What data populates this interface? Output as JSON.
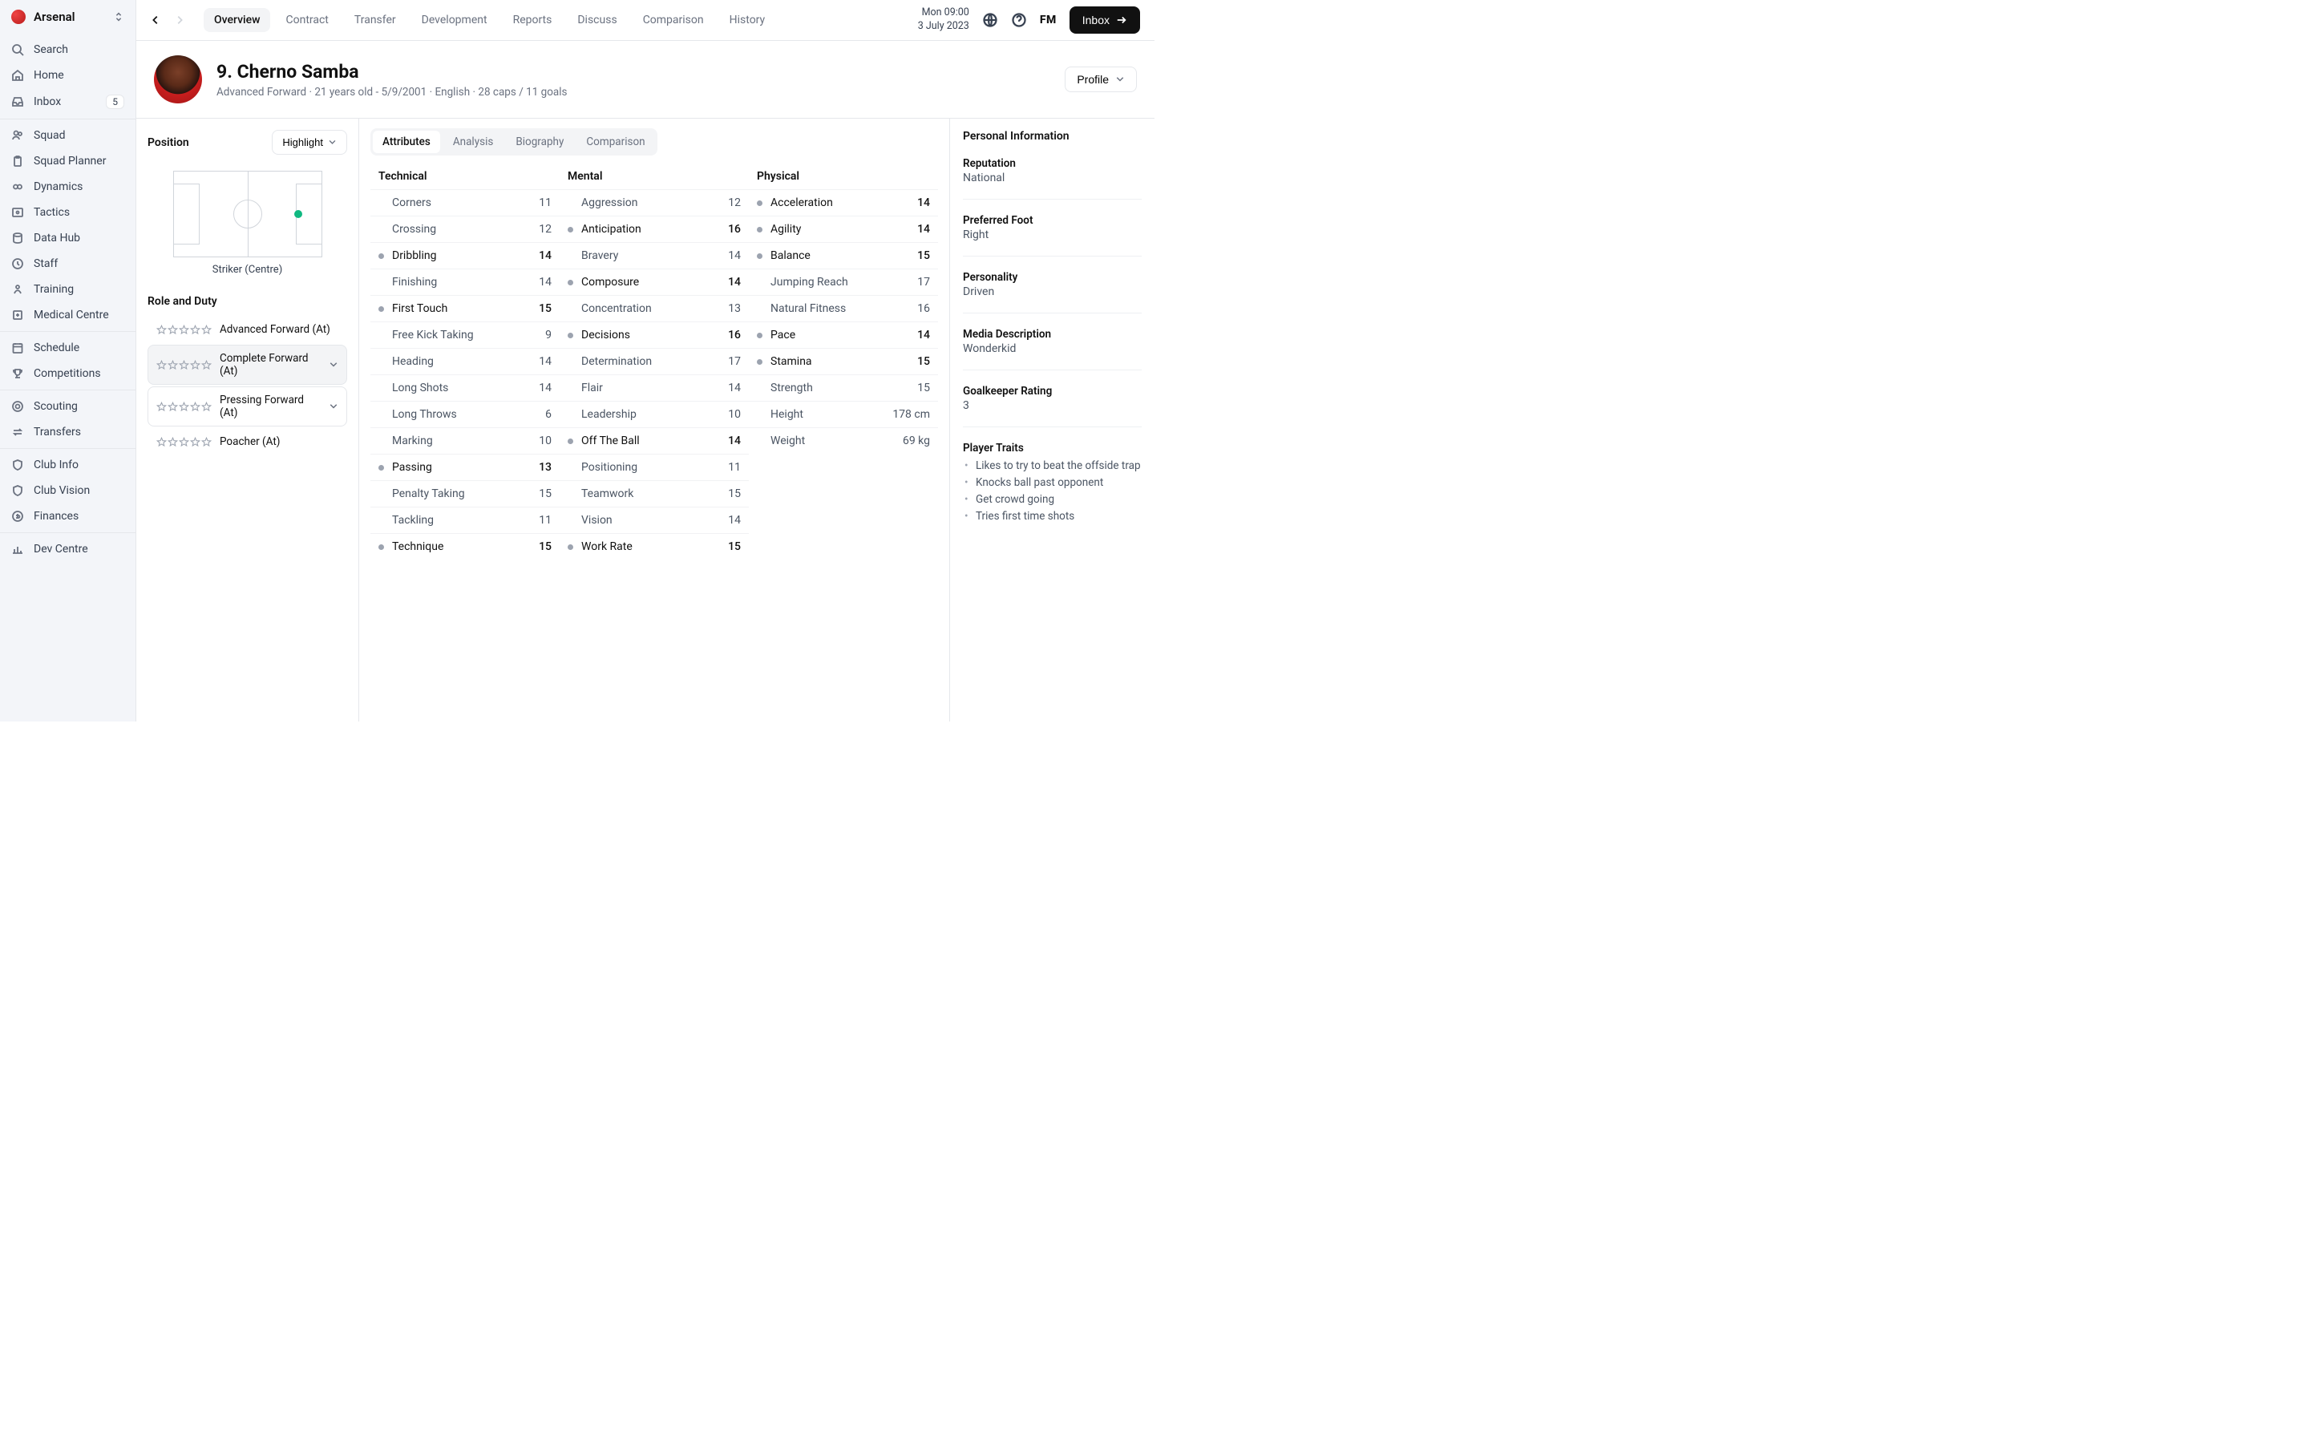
{
  "club": {
    "name": "Arsenal"
  },
  "sidebar": {
    "primary": [
      {
        "label": "Search",
        "icon": "search"
      },
      {
        "label": "Home",
        "icon": "home"
      },
      {
        "label": "Inbox",
        "icon": "inbox",
        "badge": "5"
      }
    ],
    "groups": [
      [
        {
          "label": "Squad",
          "icon": "users"
        },
        {
          "label": "Squad Planner",
          "icon": "clipboard"
        },
        {
          "label": "Dynamics",
          "icon": "link"
        },
        {
          "label": "Tactics",
          "icon": "tactics"
        },
        {
          "label": "Data Hub",
          "icon": "database"
        },
        {
          "label": "Staff",
          "icon": "clock"
        },
        {
          "label": "Training",
          "icon": "training"
        },
        {
          "label": "Medical Centre",
          "icon": "medical"
        }
      ],
      [
        {
          "label": "Schedule",
          "icon": "calendar"
        },
        {
          "label": "Competitions",
          "icon": "trophy"
        }
      ],
      [
        {
          "label": "Scouting",
          "icon": "target"
        },
        {
          "label": "Transfers",
          "icon": "transfers"
        }
      ],
      [
        {
          "label": "Club Info",
          "icon": "shield"
        },
        {
          "label": "Club Vision",
          "icon": "shield"
        },
        {
          "label": "Finances",
          "icon": "finances"
        }
      ],
      [
        {
          "label": "Dev Centre",
          "icon": "chart"
        }
      ]
    ]
  },
  "topbar": {
    "tabs": [
      "Overview",
      "Contract",
      "Transfer",
      "Development",
      "Reports",
      "Discuss",
      "Comparison",
      "History"
    ],
    "activeTab": 0,
    "time": "Mon 09:00",
    "date": "3 July 2023",
    "logo": "FM",
    "inboxButton": "Inbox"
  },
  "profileButton": "Profile",
  "player": {
    "name": "9. Cherno Samba",
    "sub": "Advanced Forward   ·  21 years old - 5/9/2001   ·  English   ·  28 caps / 11 goals"
  },
  "position": {
    "title": "Position",
    "highlight": "Highlight",
    "label": "Striker (Centre)"
  },
  "roleTitle": "Role and Duty",
  "roles": [
    {
      "label": "Advanced Forward (At)",
      "style": "plain"
    },
    {
      "label": "Complete Forward (At)",
      "style": "selected",
      "chevron": true
    },
    {
      "label": "Pressing Forward (At)",
      "style": "boxed",
      "chevron": true
    },
    {
      "label": "Poacher (At)",
      "style": "plain"
    }
  ],
  "centerTabs": [
    "Attributes",
    "Analysis",
    "Biography",
    "Comparison"
  ],
  "centerActive": 0,
  "attributes": {
    "technical": {
      "header": "Technical",
      "rows": [
        {
          "name": "Corners",
          "val": "11",
          "key": false
        },
        {
          "name": "Crossing",
          "val": "12",
          "key": false
        },
        {
          "name": "Dribbling",
          "val": "14",
          "key": true
        },
        {
          "name": "Finishing",
          "val": "14",
          "key": false
        },
        {
          "name": "First Touch",
          "val": "15",
          "key": true
        },
        {
          "name": "Free Kick Taking",
          "val": "9",
          "key": false
        },
        {
          "name": "Heading",
          "val": "14",
          "key": false
        },
        {
          "name": "Long Shots",
          "val": "14",
          "key": false
        },
        {
          "name": "Long Throws",
          "val": "6",
          "key": false
        },
        {
          "name": "Marking",
          "val": "10",
          "key": false
        },
        {
          "name": "Passing",
          "val": "13",
          "key": true
        },
        {
          "name": "Penalty Taking",
          "val": "15",
          "key": false
        },
        {
          "name": "Tackling",
          "val": "11",
          "key": false
        },
        {
          "name": "Technique",
          "val": "15",
          "key": true
        }
      ]
    },
    "mental": {
      "header": "Mental",
      "rows": [
        {
          "name": "Aggression",
          "val": "12",
          "key": false
        },
        {
          "name": "Anticipation",
          "val": "16",
          "key": true
        },
        {
          "name": "Bravery",
          "val": "14",
          "key": false
        },
        {
          "name": "Composure",
          "val": "14",
          "key": true
        },
        {
          "name": "Concentration",
          "val": "13",
          "key": false
        },
        {
          "name": "Decisions",
          "val": "16",
          "key": true
        },
        {
          "name": "Determination",
          "val": "17",
          "key": false
        },
        {
          "name": "Flair",
          "val": "14",
          "key": false
        },
        {
          "name": "Leadership",
          "val": "10",
          "key": false
        },
        {
          "name": "Off The Ball",
          "val": "14",
          "key": true
        },
        {
          "name": "Positioning",
          "val": "11",
          "key": false
        },
        {
          "name": "Teamwork",
          "val": "15",
          "key": false
        },
        {
          "name": "Vision",
          "val": "14",
          "key": false
        },
        {
          "name": "Work Rate",
          "val": "15",
          "key": true
        }
      ]
    },
    "physical": {
      "header": "Physical",
      "rows": [
        {
          "name": "Acceleration",
          "val": "14",
          "key": true
        },
        {
          "name": "Agility",
          "val": "14",
          "key": true
        },
        {
          "name": "Balance",
          "val": "15",
          "key": true
        },
        {
          "name": "Jumping Reach",
          "val": "17",
          "key": false
        },
        {
          "name": "Natural Fitness",
          "val": "16",
          "key": false
        },
        {
          "name": "Pace",
          "val": "14",
          "key": true
        },
        {
          "name": "Stamina",
          "val": "15",
          "key": true
        },
        {
          "name": "Strength",
          "val": "15",
          "key": false
        },
        {
          "name": "Height",
          "val": "178 cm",
          "key": false,
          "nodot": true
        },
        {
          "name": "Weight",
          "val": "69 kg",
          "key": false,
          "nodot": true
        }
      ]
    }
  },
  "info": {
    "title": "Personal Information",
    "blocks": [
      {
        "label": "Reputation",
        "value": "National"
      },
      {
        "label": "Preferred Foot",
        "value": "Right"
      },
      {
        "label": "Personality",
        "value": "Driven"
      },
      {
        "label": "Media Description",
        "value": "Wonderkid"
      },
      {
        "label": "Goalkeeper Rating",
        "value": "3"
      }
    ],
    "traitsLabel": "Player Traits",
    "traits": [
      "Likes to try to beat the offside trap",
      "Knocks ball past opponent",
      "Get crowd going",
      "Tries first time shots"
    ]
  }
}
